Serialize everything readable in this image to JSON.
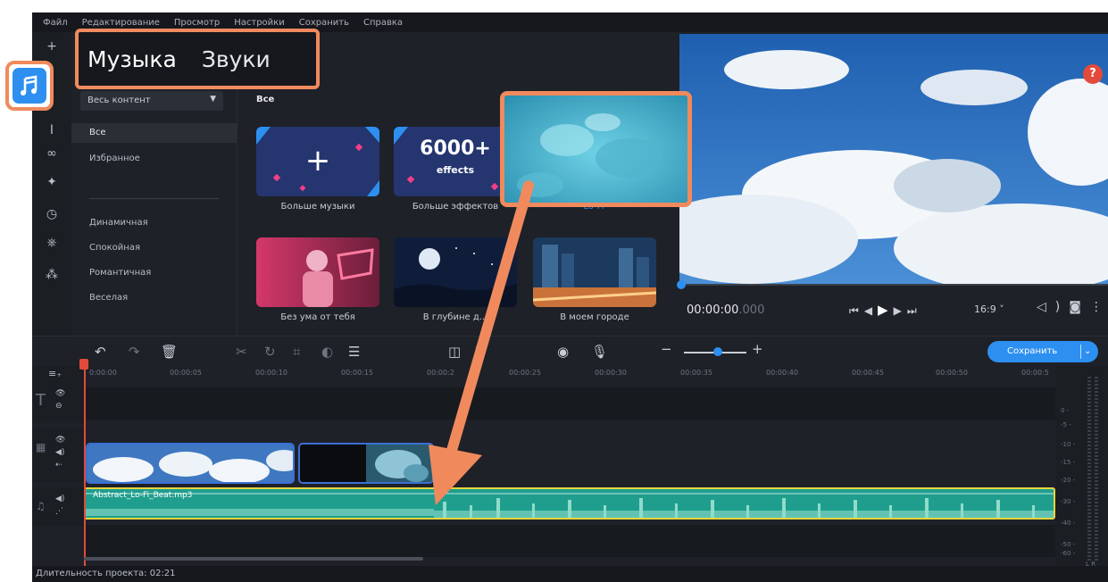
{
  "menu": [
    "Файл",
    "Редактирование",
    "Просмотр",
    "Настройки",
    "Сохранить",
    "Справка"
  ],
  "tabs": {
    "music": "Музыка",
    "sounds": "Звуки"
  },
  "library": {
    "filter": "Весь контент",
    "grid_heading": "Все",
    "categories": [
      "Все",
      "Избранное",
      "Динамичная",
      "Спокойная",
      "Романтичная",
      "Веселая"
    ],
    "tiles": [
      {
        "label": "Больше музыки",
        "badge": "+"
      },
      {
        "label": "Больше эффектов",
        "badge": "6000+",
        "badge_sub": "effects"
      },
      {
        "label": "Lo-Fi"
      },
      {
        "label": "Без ума от тебя"
      },
      {
        "label": "В глубине д..."
      },
      {
        "label": "В моем городе"
      }
    ]
  },
  "help_label": "?",
  "player": {
    "timecode": "00:00:00",
    "timecode_ms": ".000",
    "aspect": "16:9 ˅"
  },
  "toolbar": {
    "save_label": "Сохранить"
  },
  "timeline": {
    "ruler": [
      "0:00:00",
      "00:00:05",
      "00:00:10",
      "00:00:15",
      "00:00:2",
      "00:00:25",
      "00:00:30",
      "00:00:35",
      "00:00:40",
      "00:00:45",
      "00:00:50",
      "00:00:5"
    ],
    "audio_clip": "Abstract_Lo-Fi_Beat.mp3",
    "meter_scale": [
      "0 -",
      "-5 -",
      "-10 -",
      "-15 -",
      "-20 -",
      "-30 -",
      "-40 -",
      "-50 -",
      "-60 -"
    ],
    "meter_lr": "L  R"
  },
  "status": {
    "duration": "Длительность проекта: 02:21"
  },
  "colors": {
    "accent": "#2d8ff0",
    "highlight": "#f08a5d",
    "audio_clip": "#1f9e8e",
    "background": "#1e2127"
  }
}
